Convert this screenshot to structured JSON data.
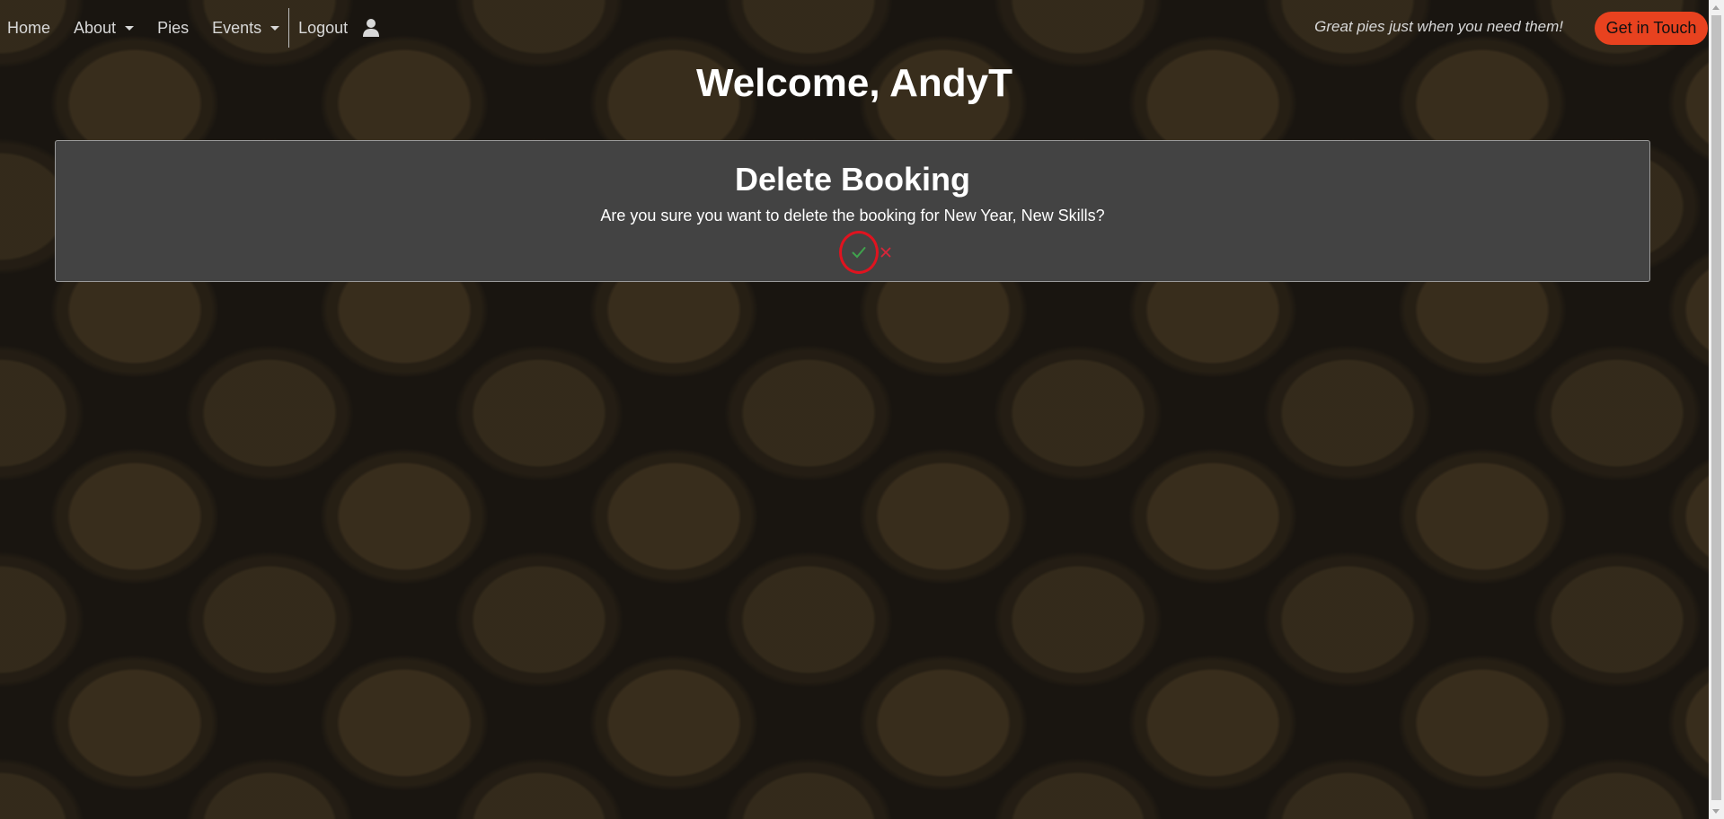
{
  "nav": {
    "items": [
      {
        "label": "Home"
      },
      {
        "label": "About"
      },
      {
        "label": "Pies"
      },
      {
        "label": "Events"
      },
      {
        "label": "Logout"
      }
    ],
    "user_icon": "user-icon",
    "tagline": "Great pies just when you need them!",
    "cta_label": "Get in Touch"
  },
  "welcome": "Welcome, AndyT",
  "dialog": {
    "title": "Delete Booking",
    "message": "Are you sure you want to delete the booking for New Year, New Skills?",
    "confirm_icon": "check-icon",
    "cancel_icon": "close-icon"
  },
  "colors": {
    "accent": "#e8421f",
    "confirm": "#3fa34d",
    "cancel": "#d9263a",
    "highlight_ring": "#e0131f"
  }
}
